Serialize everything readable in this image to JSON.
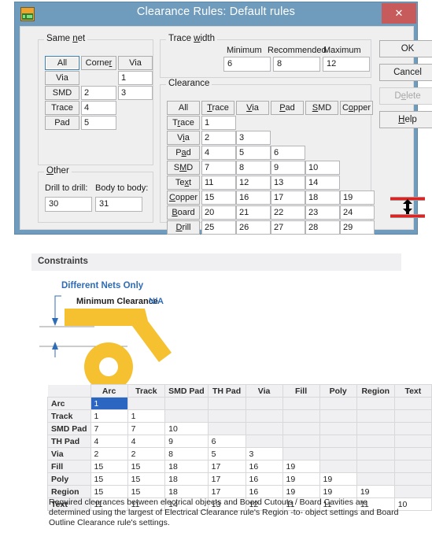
{
  "dialog": {
    "title": "Clearance Rules: Default rules",
    "app_icon": "pcb-app-icon",
    "close_label": "✕",
    "same_net": {
      "legend": "Same net",
      "legend_mnemonic": "n",
      "columns": [
        "All",
        "Corner",
        "Via"
      ],
      "rows": [
        {
          "label": "Via",
          "values": [
            "",
            "1"
          ]
        },
        {
          "label": "SMD",
          "values": [
            "2",
            "3"
          ]
        },
        {
          "label": "Trace",
          "values": [
            "4",
            null
          ]
        },
        {
          "label": "Pad",
          "values": [
            "5",
            null
          ]
        }
      ]
    },
    "other": {
      "legend": "Other",
      "drill_to_drill_label": "Drill to drill:",
      "drill_to_drill_value": "30",
      "body_to_body_label": "Body to body:",
      "body_to_body_value": "31"
    },
    "trace_width": {
      "legend": "Trace width",
      "minimum_label": "Minimum",
      "recommended_label": "Recommended",
      "maximum_label": "Maximum",
      "minimum_value": "6",
      "recommended_value": "8",
      "maximum_value": "12"
    },
    "clearance": {
      "legend": "Clearance",
      "columns": [
        "All",
        "Trace",
        "Via",
        "Pad",
        "SMD",
        "Copper"
      ],
      "rows": [
        {
          "label": "Trace",
          "values": [
            "1"
          ]
        },
        {
          "label": "Via",
          "values": [
            "2",
            "3"
          ]
        },
        {
          "label": "Pad",
          "values": [
            "4",
            "5",
            "6"
          ]
        },
        {
          "label": "SMD",
          "values": [
            "7",
            "8",
            "9",
            "10"
          ]
        },
        {
          "label": "Text",
          "values": [
            "11",
            "12",
            "13",
            "14"
          ]
        },
        {
          "label": "Copper",
          "values": [
            "15",
            "16",
            "17",
            "18",
            "19"
          ]
        },
        {
          "label": "Board",
          "values": [
            "20",
            "21",
            "22",
            "23",
            "24"
          ]
        },
        {
          "label": "Drill",
          "values": [
            "25",
            "26",
            "27",
            "28",
            "29"
          ]
        }
      ]
    },
    "buttons": {
      "ok": "OK",
      "cancel": "Cancel",
      "delete": "Delete",
      "help": "Help"
    },
    "preview_icon": "clearance-gap-icon"
  },
  "panel": {
    "constraints_header": "Constraints",
    "different_nets_only": "Different Nets Only",
    "minimum_clearance_label": "Minimum Clearance",
    "minimum_clearance_value": "N/A",
    "diagram_name": "pcb-clearance-diagram",
    "matrix": {
      "columns": [
        "Arc",
        "Track",
        "SMD Pad",
        "TH Pad",
        "Via",
        "Fill",
        "Poly",
        "Region",
        "Text"
      ],
      "rows": [
        {
          "label": "Arc",
          "values": [
            "1"
          ]
        },
        {
          "label": "Track",
          "values": [
            "1",
            "1"
          ]
        },
        {
          "label": "SMD Pad",
          "values": [
            "7",
            "7",
            "10"
          ]
        },
        {
          "label": "TH Pad",
          "values": [
            "4",
            "4",
            "9",
            "6"
          ]
        },
        {
          "label": "Via",
          "values": [
            "2",
            "2",
            "8",
            "5",
            "3"
          ]
        },
        {
          "label": "Fill",
          "values": [
            "15",
            "15",
            "18",
            "17",
            "16",
            "19"
          ]
        },
        {
          "label": "Poly",
          "values": [
            "15",
            "15",
            "18",
            "17",
            "16",
            "19",
            "19"
          ]
        },
        {
          "label": "Region",
          "values": [
            "15",
            "15",
            "18",
            "17",
            "16",
            "19",
            "19",
            "19"
          ]
        },
        {
          "label": "Text",
          "values": [
            "11",
            "11",
            "14",
            "13",
            "12",
            "11",
            "11",
            "11",
            "10"
          ]
        }
      ],
      "selected_row": 0,
      "selected_col": 0
    },
    "footer_note": "Required clearances between electrical objects and Board Cutouts / Board Cavities are determined using the largest of Electrical Clearance rule's Region -to- object settings and Board Outline Clearance rule's settings."
  },
  "colors": {
    "title_bar": "#6f9bbd",
    "close_button": "#c75b5b",
    "dialog_face": "#efeff0",
    "accent_blue": "#2f6cb5",
    "selection_blue": "#2b66c2",
    "trace_yellow": "#f5c131",
    "clearance_red": "#f21b1b"
  }
}
